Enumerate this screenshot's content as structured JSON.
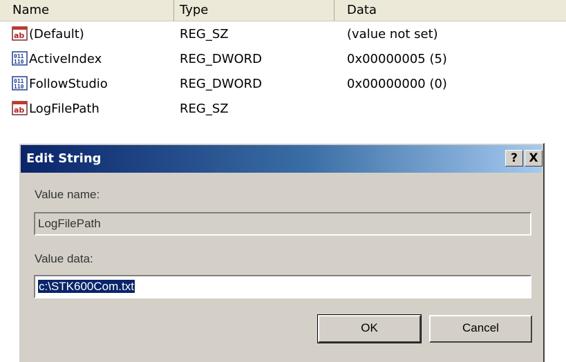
{
  "list": {
    "columns": {
      "name": "Name",
      "type": "Type",
      "data": "Data"
    },
    "rows": [
      {
        "icon": "string-value-icon",
        "name": "(Default)",
        "type": "REG_SZ",
        "data": "(value not set)"
      },
      {
        "icon": "binary-value-icon",
        "name": "ActiveIndex",
        "type": "REG_DWORD",
        "data": "0x00000005 (5)"
      },
      {
        "icon": "binary-value-icon",
        "name": "FollowStudio",
        "type": "REG_DWORD",
        "data": "0x00000000 (0)"
      },
      {
        "icon": "string-value-icon",
        "name": "LogFilePath",
        "type": "REG_SZ",
        "data": ""
      }
    ]
  },
  "dialog": {
    "title": "Edit String",
    "help_label": "?",
    "close_label": "X",
    "value_name_label": "Value name:",
    "value_name": "LogFilePath",
    "value_data_label": "Value data:",
    "value_data": "c:\\STK600Com.txt",
    "ok_label": "OK",
    "cancel_label": "Cancel"
  },
  "colors": {
    "title_gradient_start": "#0a246a",
    "title_gradient_end": "#a6caf0",
    "dialog_face": "#d4d0c8",
    "selection": "#0a246a"
  }
}
